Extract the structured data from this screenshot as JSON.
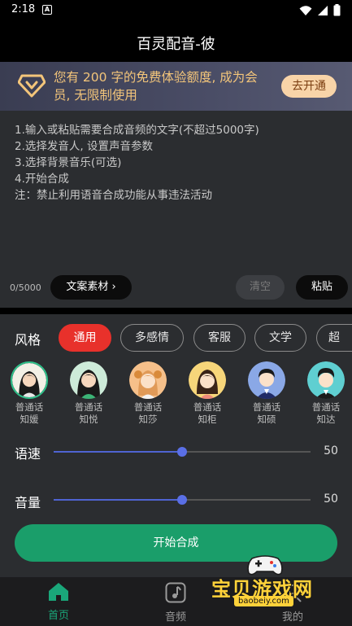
{
  "status": {
    "time": "2:18",
    "notif": "A"
  },
  "title": "百灵配音-彼",
  "promo": {
    "text": "您有 200 字的免费体验额度, 成为会员, 无限制使用",
    "button": "去开通"
  },
  "editor": {
    "instructions": [
      "1.输入或粘贴需要合成音频的文字(不超过5000字)",
      "2.选择发音人, 设置声音参数",
      "3.选择背景音乐(可选)",
      "4.开始合成",
      "注：禁止利用语音合成功能从事违法活动"
    ],
    "counter": "0/5000",
    "material_button": "文案素材",
    "clear_button": "清空",
    "paste_button": "粘贴"
  },
  "style": {
    "label": "风格",
    "chips": [
      "通用",
      "多感情",
      "客服",
      "文学",
      "超"
    ],
    "active": 0
  },
  "voices": [
    {
      "type": "普通话",
      "name": "知媛"
    },
    {
      "type": "普通话",
      "name": "知悦"
    },
    {
      "type": "普通话",
      "name": "知莎"
    },
    {
      "type": "普通话",
      "name": "知柜"
    },
    {
      "type": "普通话",
      "name": "知硕"
    },
    {
      "type": "普通话",
      "name": "知达"
    }
  ],
  "sliders": {
    "speed": {
      "label": "语速",
      "value": "50",
      "fraction": 0.5
    },
    "volume": {
      "label": "音量",
      "value": "50",
      "fraction": 0.5
    }
  },
  "start_button": "开始合成",
  "tabs": [
    {
      "label": "首页",
      "icon": "home-icon",
      "active": true
    },
    {
      "label": "音频",
      "icon": "music-note-icon",
      "active": false
    },
    {
      "label": "我的",
      "icon": "profile-icon",
      "active": false
    }
  ],
  "watermark": {
    "text": "宝贝游戏网",
    "url": "baobeiy.com"
  },
  "colors": {
    "accent_red": "#e8312b",
    "start_green": "#1a9e6a",
    "slider_blue": "#4f63d2",
    "promo_gold": "#f3c57a",
    "tab_active": "#1aa77a"
  }
}
